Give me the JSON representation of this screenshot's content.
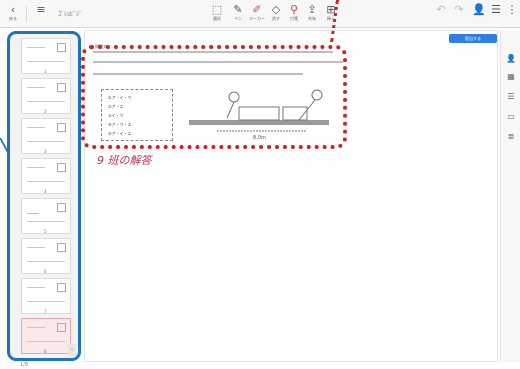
{
  "toolbar": {
    "back_label": "戻る",
    "title": "ｺﾞｼｮﾋﾞｼﾞ",
    "tools": [
      {
        "icon": "select-icon",
        "label": "選択"
      },
      {
        "icon": "pen-icon",
        "label": "ペン"
      },
      {
        "icon": "marker-icon",
        "label": "マーカー"
      },
      {
        "icon": "eraser-icon",
        "label": "消す"
      },
      {
        "icon": "pin-icon",
        "label": "付箋"
      },
      {
        "icon": "share-icon",
        "label": "共有"
      },
      {
        "icon": "insert-icon",
        "label": "挿入"
      }
    ]
  },
  "main": {
    "answer_label": "9 班の解答",
    "header_text": "問題文",
    "blue_button": "提出する",
    "options": [
      "①ア・イ・ウ",
      "②ア・エ",
      "③イ・ウ",
      "④ア・ウ・エ",
      "⑤ア・イ・エ"
    ],
    "figure_caption": "8.0m"
  },
  "thumbnails": [
    {
      "num": "1"
    },
    {
      "num": "2"
    },
    {
      "num": "3"
    },
    {
      "num": "4"
    },
    {
      "num": "5"
    },
    {
      "num": "6"
    },
    {
      "num": "7"
    },
    {
      "num": "8"
    }
  ],
  "pager": "1/8",
  "colors": {
    "panel_border": "#1f74c0",
    "highlight": "#d62020",
    "answer_text": "#c0334d",
    "accent": "#2d7fe0"
  }
}
